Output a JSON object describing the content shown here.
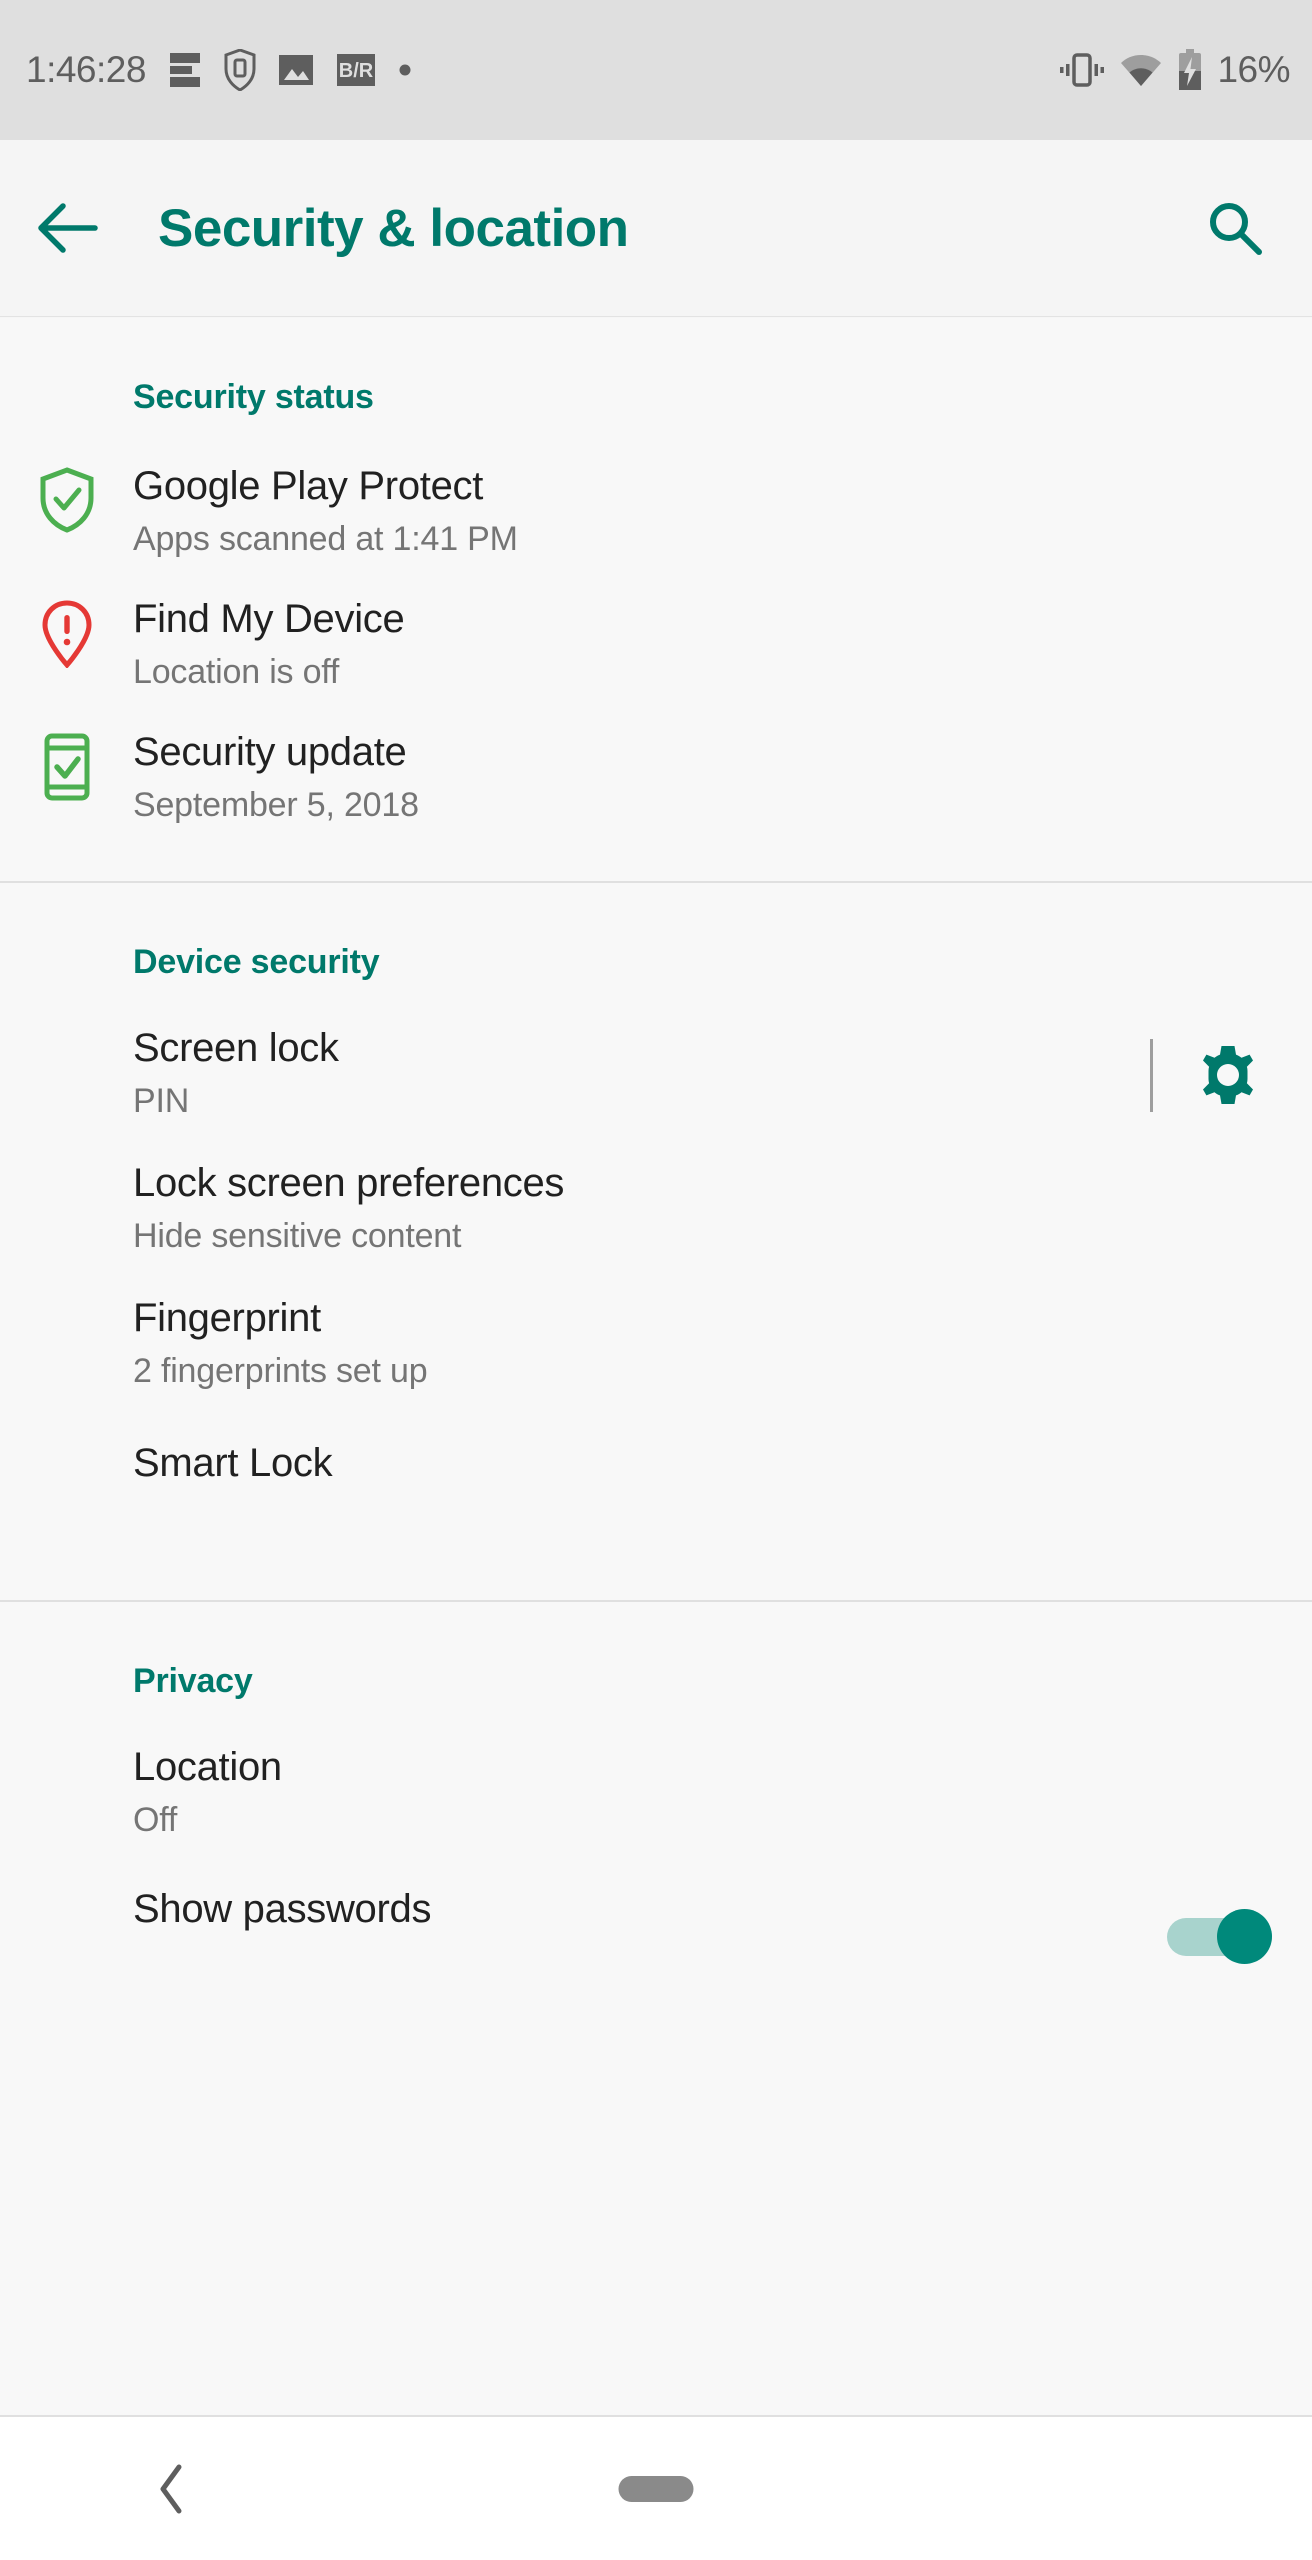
{
  "status_bar": {
    "clock": "1:46:28",
    "battery_percent": "16%",
    "left_icons": [
      "notification-lines-icon",
      "shield-phone-icon",
      "image-icon",
      "br-badge-icon",
      "dot-icon"
    ],
    "right_icons": [
      "vibrate-icon",
      "wifi-icon",
      "battery-charging-icon"
    ]
  },
  "app_bar": {
    "back_icon": "arrow-back-icon",
    "title": "Security & location",
    "search_icon": "search-icon"
  },
  "colors": {
    "accent_teal": "#00796b",
    "shield_green": "#4caf50",
    "pin_red": "#e53935",
    "title_text": "#212121",
    "summary_text": "#757575"
  },
  "sections": [
    {
      "header": "Security status",
      "rows": [
        {
          "icon": "shield-check-icon",
          "title": "Google Play Protect",
          "summary": "Apps scanned at 1:41 PM"
        },
        {
          "icon": "location-pin-alert-icon",
          "title": "Find My Device",
          "summary": "Location is off"
        },
        {
          "icon": "phone-check-icon",
          "title": "Security update",
          "summary": "September 5, 2018"
        }
      ]
    },
    {
      "header": "Device security",
      "rows": [
        {
          "title": "Screen lock",
          "summary": "PIN",
          "widget": "gear",
          "gear_icon": "gear-icon"
        },
        {
          "title": "Lock screen preferences",
          "summary": "Hide sensitive content"
        },
        {
          "title": "Fingerprint",
          "summary": "2 fingerprints set up"
        },
        {
          "title": "Smart Lock",
          "summary": ""
        }
      ]
    },
    {
      "header": "Privacy",
      "rows": [
        {
          "title": "Location",
          "summary": "Off"
        },
        {
          "title": "Show passwords",
          "summary": "",
          "widget": "switch",
          "switch_state": "on"
        }
      ]
    }
  ],
  "nav_bar": {
    "back_icon": "nav-back-chevron-icon",
    "home_icon": "nav-home-pill-icon"
  }
}
